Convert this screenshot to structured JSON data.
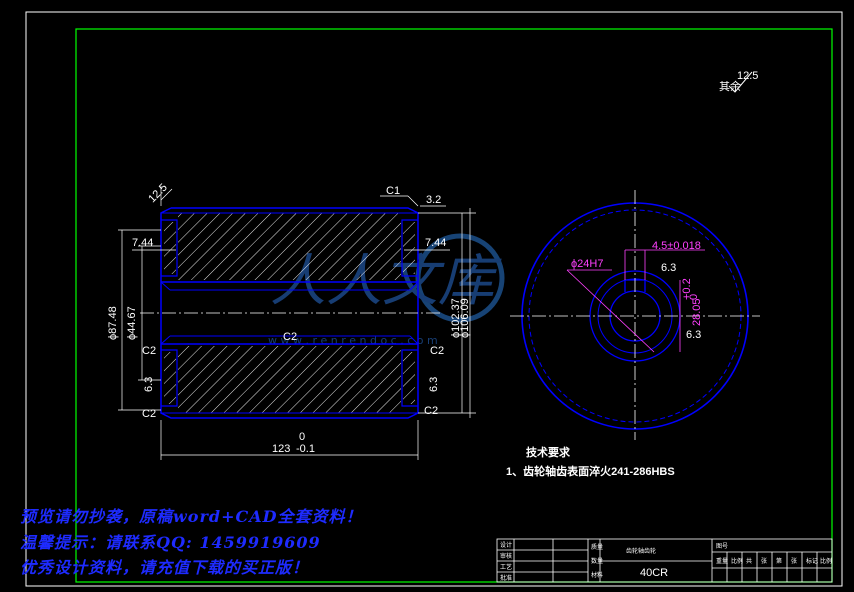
{
  "colors": {
    "frame": "#00ff00",
    "outline": "#0000ff",
    "hatch": "#ffffff",
    "dimension": "#00e5e5",
    "note": "#ff40ff",
    "promo": "#1e2bff"
  },
  "roughness": {
    "value": "12.5",
    "suffix": "其余"
  },
  "section_view": {
    "top_chamfer": "12.5",
    "chamfer_c1": "C1",
    "surface_32": "3.2",
    "dim_744_left": "7.44",
    "dim_744_right": "7.44",
    "dia_8748": "ϕ87.48",
    "dia_4467": "ϕ44.67",
    "bore_chamfer": "C2",
    "left_c2_upper": "C2",
    "left_c2_lower": "C2",
    "right_c2_upper": "C2",
    "right_c2_lower": "C2",
    "left_63": "6.3",
    "right_63": "6.3",
    "dia_10237": "ϕ102.37",
    "dia_10609": "ϕ106.09",
    "length": "123",
    "length_tol_upper": "0",
    "length_tol_lower": "-0.1"
  },
  "end_view": {
    "bore_fit": "ϕ24H7",
    "keyway_width": "4.5±0.018",
    "keyway_rough": "6.3",
    "bore_rough": "6.3",
    "keyway_depth": "28.05",
    "keyway_tol_upper": "+0.2",
    "keyway_tol_lower": "0"
  },
  "tech_req": {
    "title": "技术要求",
    "item1": "1、齿轮轴齿表面淬火241-286HBS"
  },
  "watermark": {
    "text": "w w w . r e n r e n d o c . c o m"
  },
  "promo": {
    "line1": "预览请勿抄袭，原稿word+CAD全套资料！",
    "line2": "温馨提示：请联系QQ: 1459919609",
    "line3": "优秀设计资料，请充值下载的买正版！"
  },
  "title_block": {
    "part_name": "齿轮轴齿轮",
    "material": "40CR",
    "scale_label": "比例",
    "row_labels": [
      "设计",
      "审核",
      "工艺",
      "批准"
    ],
    "mid_labels": [
      "质量",
      "数量",
      "材料"
    ],
    "drawing_no_label": "图号",
    "sign_labels": [
      "重量",
      "比例",
      "共",
      "张",
      "第",
      "张",
      "标记"
    ]
  }
}
